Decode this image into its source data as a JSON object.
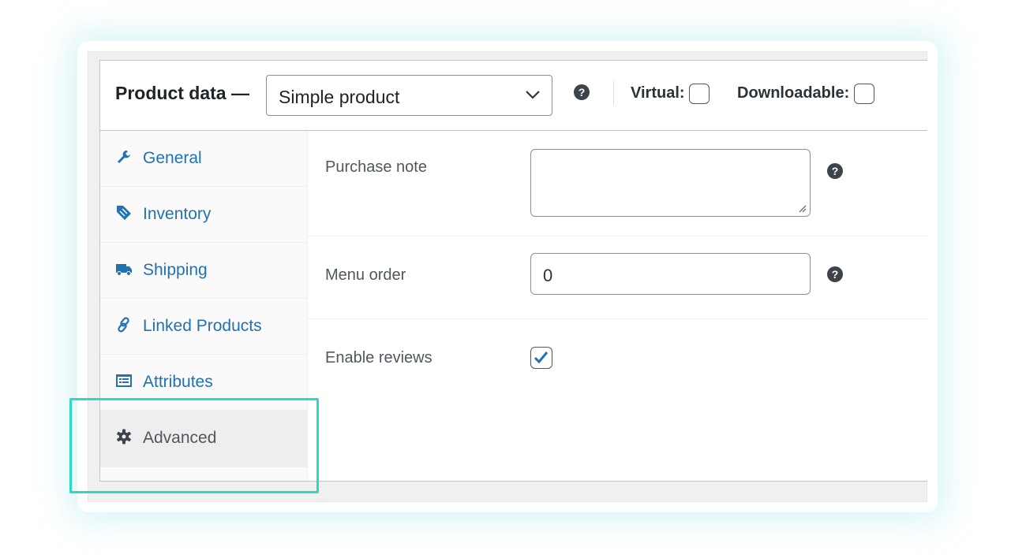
{
  "header": {
    "title": "Product data —",
    "product_type": "Simple product",
    "virtual_label": "Virtual:",
    "virtual_checked": false,
    "downloadable_label": "Downloadable:",
    "downloadable_checked": false
  },
  "tabs": [
    {
      "label": "General",
      "icon": "wrench-icon",
      "active": false
    },
    {
      "label": "Inventory",
      "icon": "tag-icon",
      "active": false
    },
    {
      "label": "Shipping",
      "icon": "truck-icon",
      "active": false
    },
    {
      "label": "Linked Products",
      "icon": "link-icon",
      "active": false
    },
    {
      "label": "Attributes",
      "icon": "list-icon",
      "active": false
    },
    {
      "label": "Advanced",
      "icon": "gear-icon",
      "active": true
    }
  ],
  "advanced": {
    "purchase_note_label": "Purchase note",
    "purchase_note_value": "",
    "menu_order_label": "Menu order",
    "menu_order_value": "0",
    "enable_reviews_label": "Enable reviews",
    "enable_reviews_checked": true
  },
  "colors": {
    "link": "#2271b1",
    "highlight": "#2fd8c6",
    "active_tab_bg": "#eeeeee"
  }
}
